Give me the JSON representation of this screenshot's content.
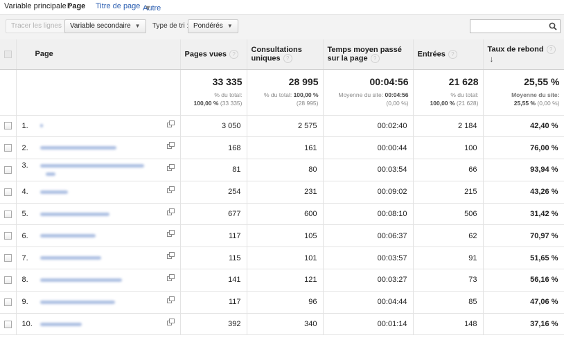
{
  "topbar": {
    "label": "Variable principale :",
    "active": "Page",
    "link1": "Titre de page",
    "link2": "Autre"
  },
  "toolbar": {
    "plot_rows": "Tracer les lignes",
    "secondary": "Variable secondaire",
    "sort_type_label": "Type de tri :",
    "sort_type_value": "Pondérés"
  },
  "columns": {
    "page": "Page",
    "pageviews": "Pages vues",
    "unique": "Consultations uniques",
    "time": "Temps moyen passé sur la page",
    "entrances": "Entrées",
    "bounce": "Taux de rebond"
  },
  "totals": {
    "pageviews": {
      "value": "33 335",
      "pct_label": "% du total:",
      "pct": "100,00 %",
      "paren": "(33 335)"
    },
    "unique": {
      "value": "28 995",
      "pct_label": "% du total:",
      "pct": "100,00 %",
      "paren": "(28 995)"
    },
    "time": {
      "value": "00:04:56",
      "avg_label": "Moyenne du site:",
      "avg": "00:04:56",
      "paren": "(0,00 %)"
    },
    "entrances": {
      "value": "21 628",
      "pct_label": "% du total:",
      "pct": "100,00 %",
      "paren": "(21 628)"
    },
    "bounce": {
      "value": "25,55 %",
      "avg_label": "Moyenne du site:",
      "avg": "25,55 %",
      "paren": "(0,00 %)"
    }
  },
  "rows": [
    {
      "idx": "1.",
      "pageviews": "3 050",
      "unique": "2 575",
      "time": "00:02:40",
      "entrances": "2 184",
      "bounce": "42,40 %"
    },
    {
      "idx": "2.",
      "pageviews": "168",
      "unique": "161",
      "time": "00:00:44",
      "entrances": "100",
      "bounce": "76,00 %"
    },
    {
      "idx": "3.",
      "pageviews": "81",
      "unique": "80",
      "time": "00:03:54",
      "entrances": "66",
      "bounce": "93,94 %"
    },
    {
      "idx": "4.",
      "pageviews": "254",
      "unique": "231",
      "time": "00:09:02",
      "entrances": "215",
      "bounce": "43,26 %"
    },
    {
      "idx": "5.",
      "pageviews": "677",
      "unique": "600",
      "time": "00:08:10",
      "entrances": "506",
      "bounce": "31,42 %"
    },
    {
      "idx": "6.",
      "pageviews": "117",
      "unique": "105",
      "time": "00:06:37",
      "entrances": "62",
      "bounce": "70,97 %"
    },
    {
      "idx": "7.",
      "pageviews": "115",
      "unique": "101",
      "time": "00:03:57",
      "entrances": "91",
      "bounce": "51,65 %"
    },
    {
      "idx": "8.",
      "pageviews": "141",
      "unique": "121",
      "time": "00:03:27",
      "entrances": "73",
      "bounce": "56,16 %"
    },
    {
      "idx": "9.",
      "pageviews": "117",
      "unique": "96",
      "time": "00:04:44",
      "entrances": "85",
      "bounce": "47,06 %"
    },
    {
      "idx": "10.",
      "pageviews": "392",
      "unique": "340",
      "time": "00:01:14",
      "entrances": "148",
      "bounce": "37,16 %"
    }
  ]
}
